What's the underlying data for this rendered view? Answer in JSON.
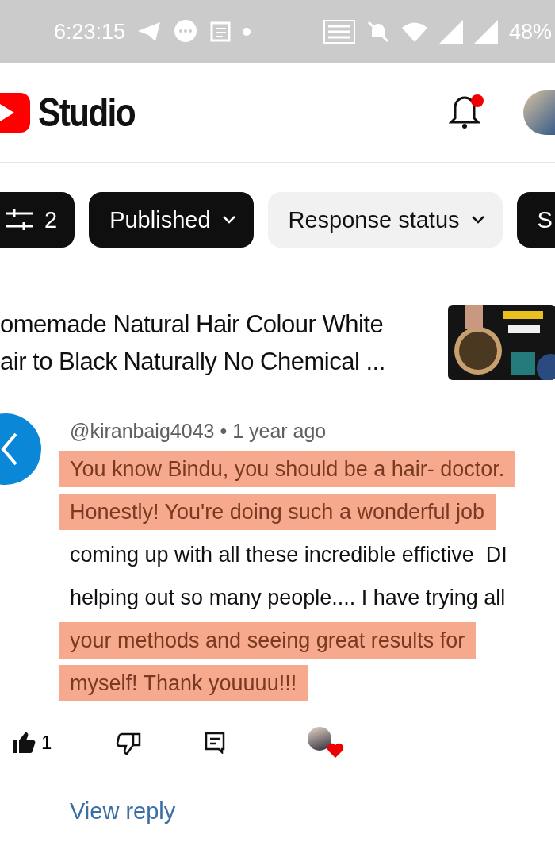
{
  "status_bar": {
    "time": "6:23:15",
    "battery": "48%"
  },
  "header": {
    "logo_text": "Studio",
    "notification_dot": true
  },
  "filters": [
    {
      "kind": "count",
      "label": "2",
      "selected": true
    },
    {
      "kind": "dropdown",
      "label": "Published",
      "selected": true
    },
    {
      "kind": "dropdown",
      "label": "Response status",
      "selected": false
    },
    {
      "kind": "dropdown",
      "label": "S",
      "selected": true
    }
  ],
  "video": {
    "title_lines": [
      "omemade Natural Hair Colour White",
      "air to Black Naturally No Chemical ..."
    ]
  },
  "comment": {
    "author": "@kiranbaig4043",
    "separator": "•",
    "time": "1 year ago",
    "lines": [
      {
        "text": "You know Bindu, you should be a hair- doctor.",
        "highlighted": true
      },
      {
        "text": "Honestly! You're doing such a wonderful job",
        "highlighted": true
      },
      {
        "text": "coming up with all these incredible effictive  DI",
        "highlighted": false
      },
      {
        "text": "helping out so many people.... I have trying all",
        "highlighted": false
      },
      {
        "text": "your methods and seeing great results for",
        "highlighted": true
      },
      {
        "text": "myself! Thank youuuu!!!",
        "highlighted": true
      }
    ],
    "likes": "1",
    "liked": true,
    "creator_hearted": true
  },
  "view_reply": "View reply"
}
